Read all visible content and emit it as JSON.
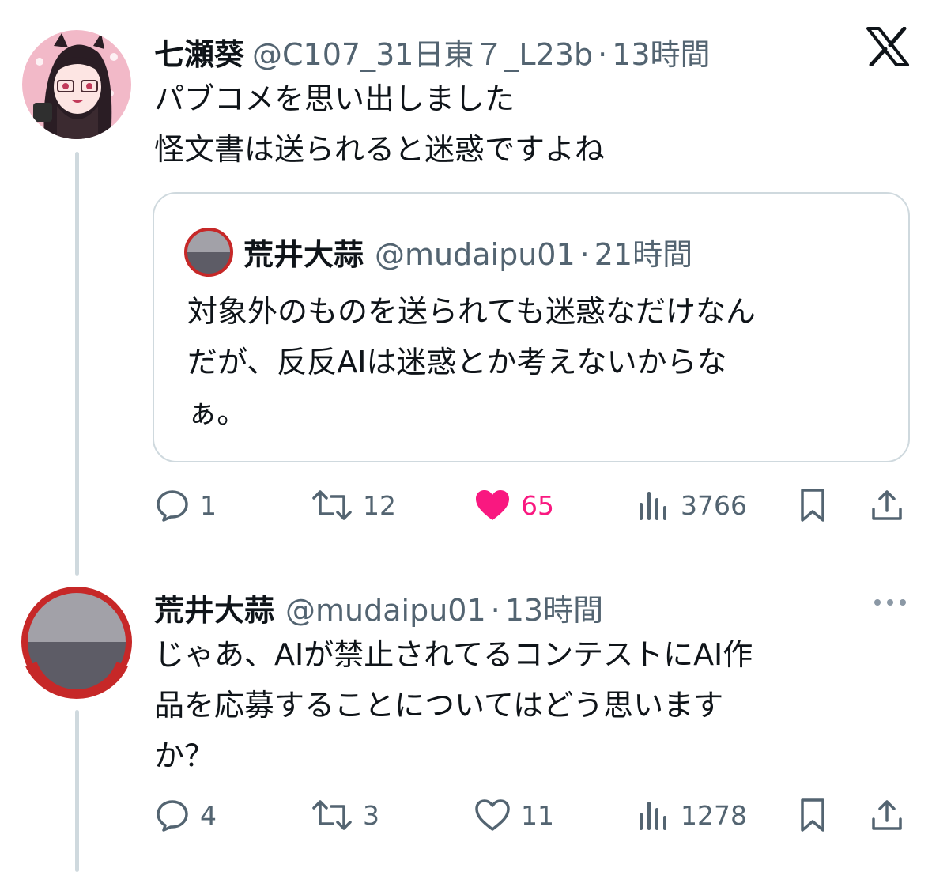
{
  "brand": {
    "logo_icon": "x-logo-icon"
  },
  "colors": {
    "like_active": "#f91880",
    "secondary_text": "#536471",
    "thread_line": "#cfd9de"
  },
  "tweets": [
    {
      "display_name": "七瀬葵",
      "handle": "@C107_31日東７_L23b",
      "separator": "·",
      "time": "13時間",
      "lines": [
        "パブコメを思い出しました",
        "怪文書は送られると迷惑ですよね"
      ],
      "quote": {
        "display_name": "荒井大蒜",
        "handle": "@mudaipu01",
        "separator": "·",
        "time": "21時間",
        "lines": [
          "対象外のものを送られても迷惑なだけなん",
          "だが、反反AIは迷惑とか考えないからな",
          "ぁ。"
        ]
      },
      "actions": {
        "replies": "1",
        "reposts": "12",
        "likes": "65",
        "views": "3766",
        "liked": true
      }
    },
    {
      "display_name": "荒井大蒜",
      "handle": "@mudaipu01",
      "separator": "·",
      "time": "13時間",
      "lines": [
        "じゃあ、AIが禁止されてるコンテストにAI作",
        "品を応募することについてはどう思います",
        "か？"
      ],
      "actions": {
        "replies": "4",
        "reposts": "3",
        "likes": "11",
        "views": "1278",
        "liked": false
      }
    }
  ]
}
